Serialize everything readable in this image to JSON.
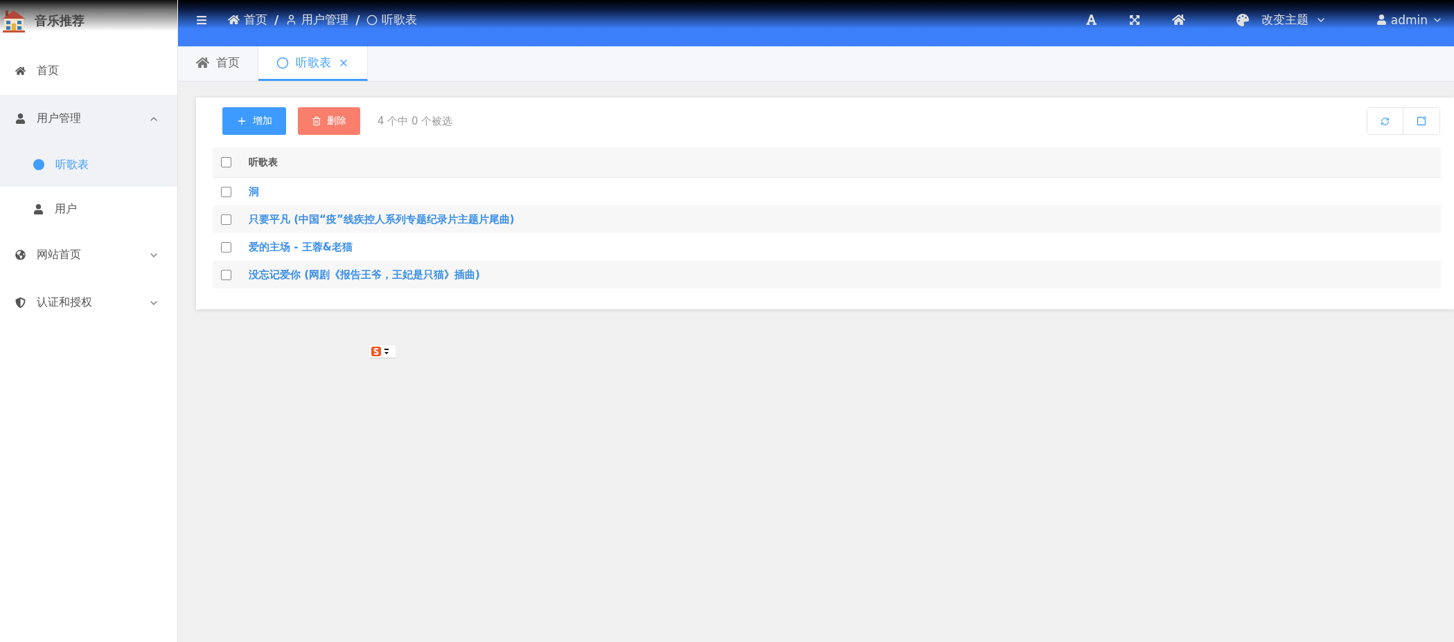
{
  "app": {
    "title": "音乐推荐"
  },
  "sidebar": {
    "items": [
      {
        "label": "首页",
        "selected": false
      },
      {
        "label": "用户管理",
        "expanded": true,
        "selected": false,
        "children": [
          {
            "label": "听歌表",
            "selected": true
          },
          {
            "label": "用户",
            "selected": false
          }
        ]
      },
      {
        "label": "网站首页",
        "expanded": false,
        "selected": false
      },
      {
        "label": "认证和授权",
        "expanded": false,
        "selected": false
      }
    ]
  },
  "header": {
    "breadcrumb": [
      {
        "label": "首页",
        "separator": "/"
      },
      {
        "label": "用户管理",
        "separator": "/"
      },
      {
        "label": "听歌表"
      }
    ],
    "theme_menu": "改变主题",
    "user_menu": "admin"
  },
  "tabs": [
    {
      "label": "首页",
      "selected": false
    },
    {
      "label": "听歌表",
      "selected": true
    }
  ],
  "toolbar": {
    "add_button": "增加",
    "delete_button": "删除",
    "selection_info": "4 个中 0 个被选"
  },
  "table": {
    "select_all_checked": false,
    "columns": [
      "听歌表"
    ],
    "rows": [
      {
        "title": "洞",
        "checked": false
      },
      {
        "title": "只要平凡 (中国“疫”线疾控人系列专题纪录片主题片尾曲)",
        "checked": false
      },
      {
        "title": "爱的主场 - 王蓉&老猫",
        "checked": false
      },
      {
        "title": "没忘记爱你 (网剧《报告王爷，王妃是只猫》插曲)",
        "checked": false
      }
    ]
  }
}
